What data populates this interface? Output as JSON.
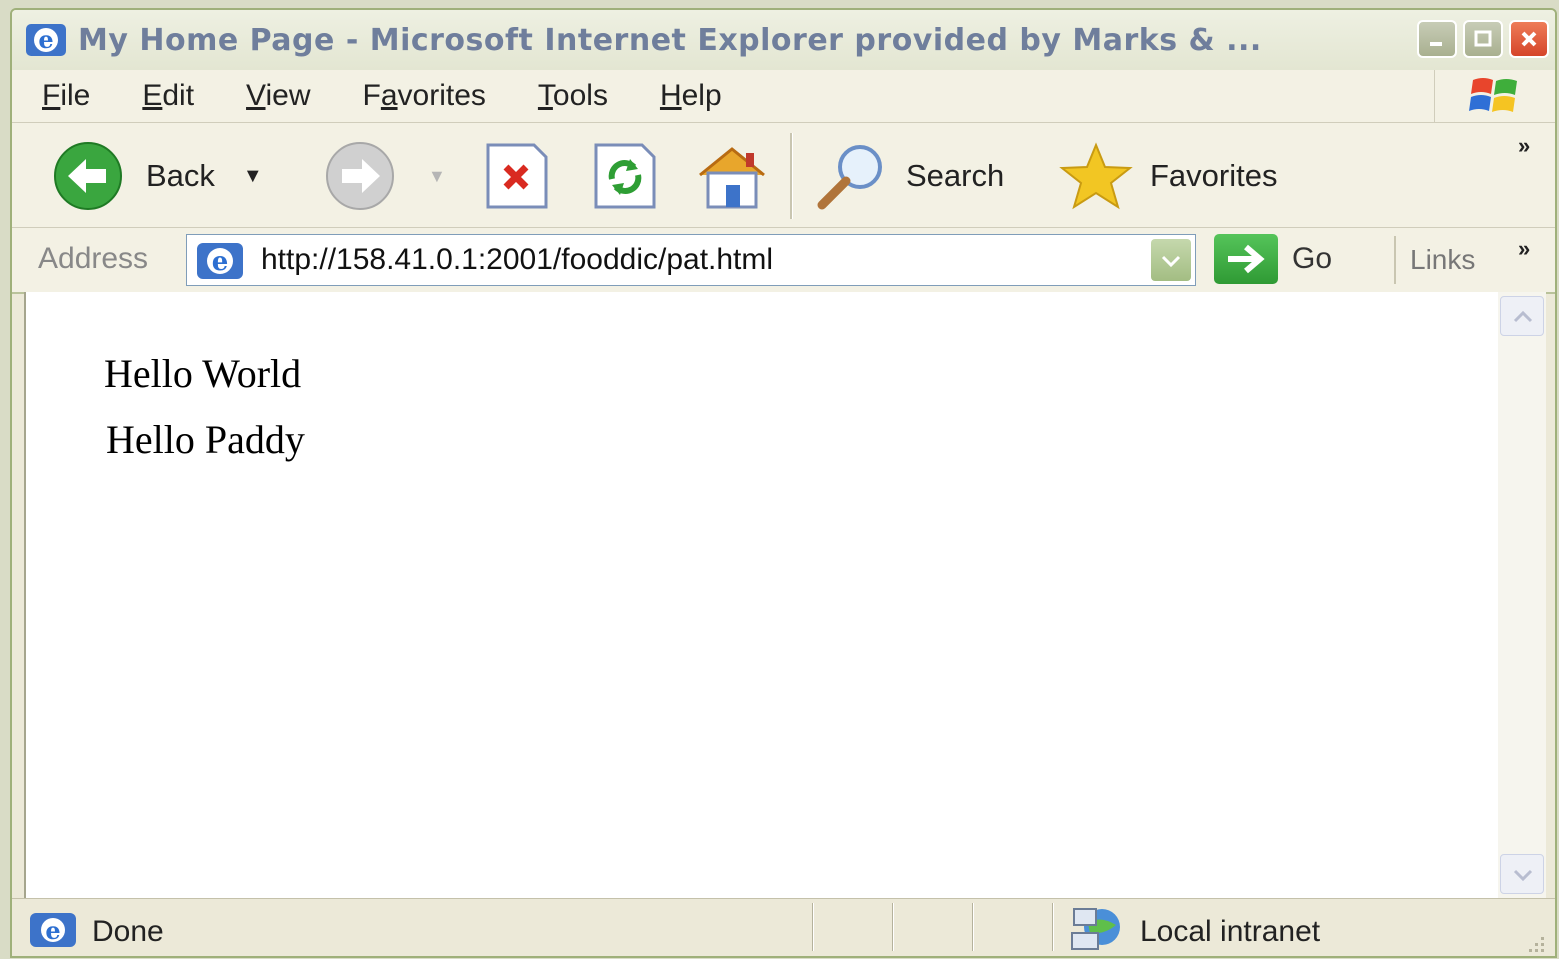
{
  "window": {
    "title": "My Home Page - Microsoft Internet Explorer provided by Marks & ..."
  },
  "menu": {
    "items": [
      {
        "label": "File",
        "mnemonic": "F",
        "rest": "ile"
      },
      {
        "label": "Edit",
        "mnemonic": "E",
        "rest": "dit"
      },
      {
        "label": "View",
        "mnemonic": "V",
        "rest": "iew"
      },
      {
        "label": "Favorites",
        "mnemonic": "a",
        "pre": "F",
        "rest": "vorites"
      },
      {
        "label": "Tools",
        "mnemonic": "T",
        "rest": "ools"
      },
      {
        "label": "Help",
        "mnemonic": "H",
        "rest": "elp"
      }
    ]
  },
  "toolbar": {
    "back_label": "Back",
    "search_label": "Search",
    "favorites_label": "Favorites",
    "overflow": "»"
  },
  "address": {
    "label": "Address",
    "url": "http://158.41.0.1:2001/fooddic/pat.html",
    "go_label": "Go",
    "links_label": "Links",
    "overflow": "»"
  },
  "page": {
    "lines": [
      "Hello World",
      "Hello Paddy"
    ]
  },
  "status": {
    "text": "Done",
    "zone": "Local intranet"
  },
  "icons": {
    "back": "back-arrow-icon",
    "forward": "forward-arrow-icon",
    "stop": "stop-icon",
    "refresh": "refresh-icon",
    "home": "home-icon",
    "search": "magnifier-icon",
    "favorites": "star-icon"
  },
  "colors": {
    "back_green": "#3aa63f",
    "stop_red": "#d92a20",
    "star_yellow": "#f2c623",
    "close_red": "#d5452a",
    "ie_blue": "#2d6fd1"
  }
}
